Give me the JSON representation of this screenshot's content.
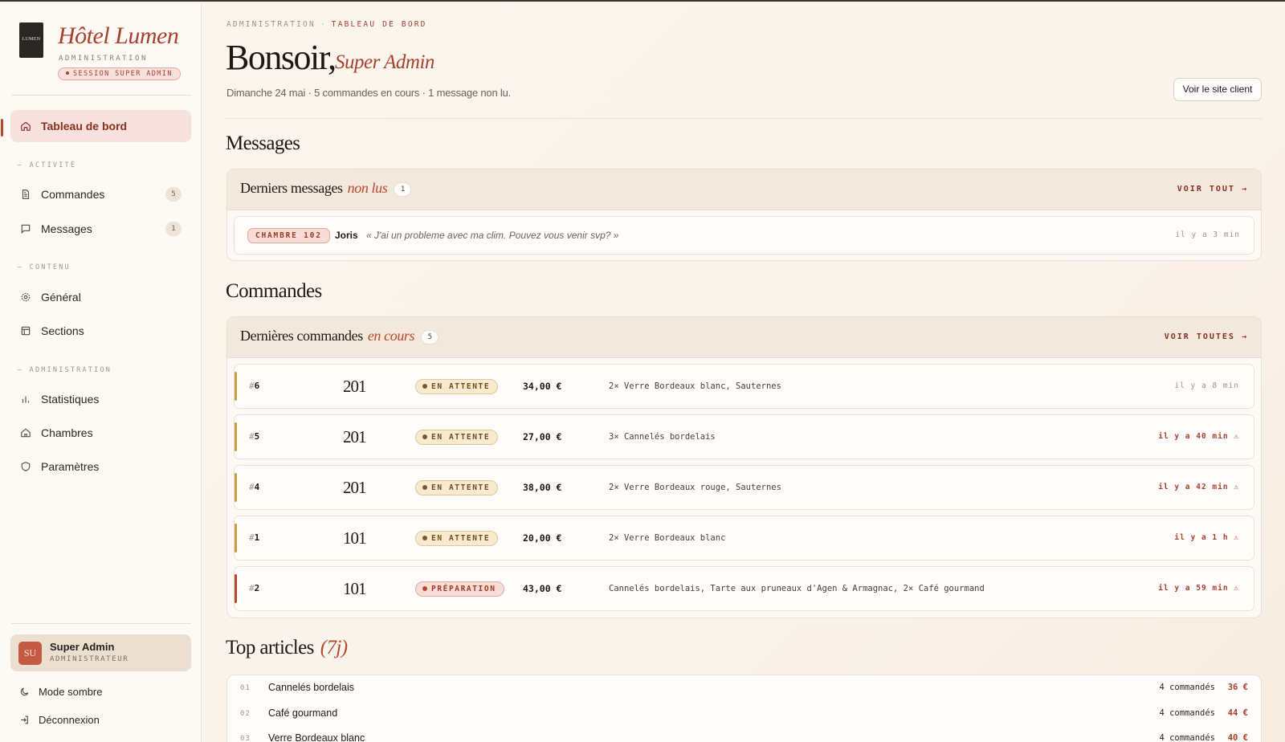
{
  "brand": {
    "name": "Hôtel Lumen",
    "logo_text": "LUMEN",
    "subtitle": "ADMINISTRATION",
    "session_badge": "SESSION SUPER ADMIN"
  },
  "sidebar": {
    "dashboard": "Tableau de bord",
    "sections": [
      {
        "label": "— ACTIVITÉ"
      },
      {
        "label": "— CONTENU"
      },
      {
        "label": "— ADMINISTRATION"
      }
    ],
    "items": {
      "commandes": {
        "label": "Commandes",
        "count": "5"
      },
      "messages": {
        "label": "Messages",
        "count": "1"
      },
      "general": {
        "label": "Général"
      },
      "sections": {
        "label": "Sections"
      },
      "statistiques": {
        "label": "Statistiques"
      },
      "chambres": {
        "label": "Chambres"
      },
      "parametres": {
        "label": "Paramètres"
      }
    },
    "user": {
      "initials": "SU",
      "name": "Super Admin",
      "role": "ADMINISTRATEUR"
    },
    "dark_mode": "Mode sombre",
    "logout": "Déconnexion"
  },
  "header": {
    "breadcrumb": [
      "ADMINISTRATION",
      "TABLEAU DE BORD"
    ],
    "greeting": "Bonsoir,",
    "greeting_name": "Super Admin",
    "subline": "Dimanche 24 mai · 5 commandes en cours · 1 message non lu.",
    "client_button": "Voir le site client"
  },
  "messages": {
    "title": "Messages",
    "panel_title": "Derniers messages",
    "panel_title_accent": "non lus",
    "count": "1",
    "link": "VOIR TOUT →",
    "items": [
      {
        "room": "CHAMBRE 102",
        "from": "Joris",
        "text": "« J'ai un probleme avec ma clim. Pouvez vous venir svp? »",
        "time": "il y a 3 min"
      }
    ]
  },
  "orders": {
    "title": "Commandes",
    "panel_title": "Dernières commandes",
    "panel_title_accent": "en cours",
    "count": "5",
    "link": "VOIR TOUTES →",
    "items": [
      {
        "id": "6",
        "room": "201",
        "status": "EN ATTENTE",
        "price": "34,00 €",
        "items": "2× Verre Bordeaux blanc, Sauternes",
        "time": "il y a 8 min"
      },
      {
        "id": "5",
        "room": "201",
        "status": "EN ATTENTE",
        "price": "27,00 €",
        "items": "3× Cannelés bordelais",
        "time": "il y a 40 min ⚠"
      },
      {
        "id": "4",
        "room": "201",
        "status": "EN ATTENTE",
        "price": "38,00 €",
        "items": "2× Verre Bordeaux rouge, Sauternes",
        "time": "il y a 42 min ⚠"
      },
      {
        "id": "1",
        "room": "101",
        "status": "EN ATTENTE",
        "price": "20,00 €",
        "items": "2× Verre Bordeaux blanc",
        "time": "il y a 1 h ⚠"
      },
      {
        "id": "2",
        "room": "101",
        "status": "PRÉPARATION",
        "price": "43,00 €",
        "items": "Cannelés bordelais, Tarte aux pruneaux d'Agen & Armagnac, 2× Café gourmand",
        "time": "il y a 59 min ⚠"
      }
    ]
  },
  "top": {
    "title": "Top articles",
    "title_accent": "(7j)",
    "items": [
      {
        "rank": "01",
        "name": "Cannelés bordelais",
        "qty": "4 commandés",
        "amount": "36 €"
      },
      {
        "rank": "02",
        "name": "Café gourmand",
        "qty": "4 commandés",
        "amount": "44 €"
      },
      {
        "rank": "03",
        "name": "Verre Bordeaux blanc",
        "qty": "4 commandés",
        "amount": "40 €"
      }
    ]
  },
  "colors": {
    "accent": "#a8402d",
    "pending": "#d29a3c",
    "background": "#fbf5ee"
  }
}
